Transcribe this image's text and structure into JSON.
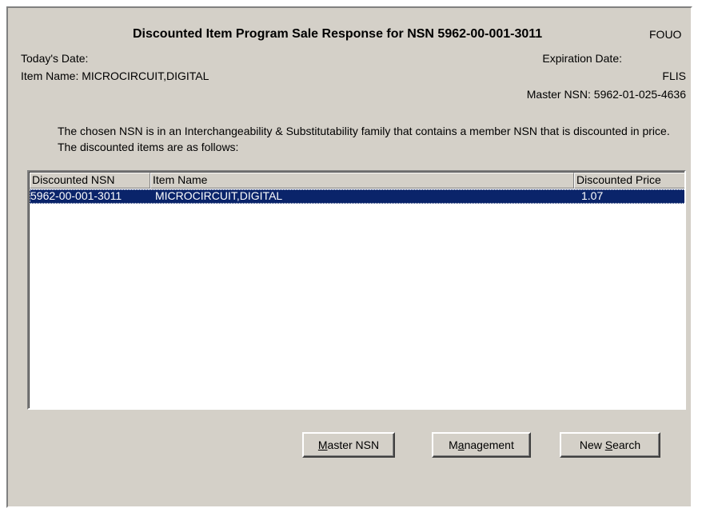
{
  "title": {
    "main": "Discounted Item Program Sale Response for NSN  5962-00-001-3011",
    "classification": "FOUO"
  },
  "info": {
    "todays_date_label": "Today's Date:",
    "item_name_label": "Item Name: MICROCIRCUIT,DIGITAL",
    "expiration_date_label": "Expiration Date:",
    "source": "FLIS",
    "master_nsn_label": "Master NSN: 5962-01-025-4636"
  },
  "intro_text": "The chosen NSN is in an Interchangeability & Substitutability family that contains a member NSN that is discounted in price.  The discounted items are as follows:",
  "list": {
    "columns": [
      "Discounted NSN",
      "Item Name",
      "Discounted Price"
    ],
    "rows": [
      {
        "nsn": "5962-00-001-3011",
        "item_name": "MICROCIRCUIT,DIGITAL",
        "price": "1.07",
        "selected": true
      }
    ]
  },
  "buttons": {
    "master_nsn": {
      "pre": "",
      "accel": "M",
      "post": "aster NSN"
    },
    "management": {
      "pre": "M",
      "accel": "a",
      "post": "nagement"
    },
    "new_search": {
      "pre": "New ",
      "accel": "S",
      "post": "earch"
    }
  },
  "colors": {
    "dialog_bg": "#d4d0c8",
    "selection_bg": "#0a246a",
    "selection_fg": "#ffffff"
  }
}
